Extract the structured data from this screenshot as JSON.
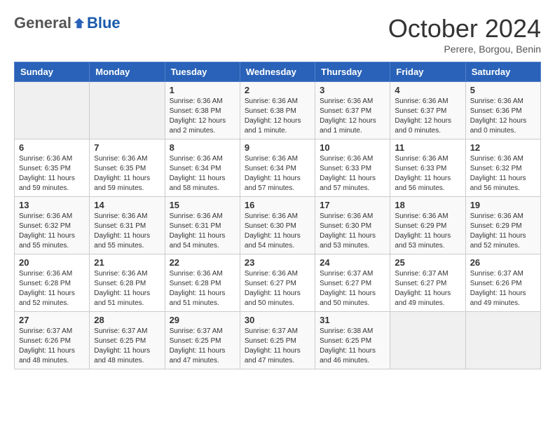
{
  "header": {
    "logo_general": "General",
    "logo_blue": "Blue",
    "month_title": "October 2024",
    "subtitle": "Perere, Borgou, Benin"
  },
  "days_of_week": [
    "Sunday",
    "Monday",
    "Tuesday",
    "Wednesday",
    "Thursday",
    "Friday",
    "Saturday"
  ],
  "weeks": [
    [
      {
        "day": "",
        "detail": ""
      },
      {
        "day": "",
        "detail": ""
      },
      {
        "day": "1",
        "detail": "Sunrise: 6:36 AM\nSunset: 6:38 PM\nDaylight: 12 hours\nand 2 minutes."
      },
      {
        "day": "2",
        "detail": "Sunrise: 6:36 AM\nSunset: 6:38 PM\nDaylight: 12 hours\nand 1 minute."
      },
      {
        "day": "3",
        "detail": "Sunrise: 6:36 AM\nSunset: 6:37 PM\nDaylight: 12 hours\nand 1 minute."
      },
      {
        "day": "4",
        "detail": "Sunrise: 6:36 AM\nSunset: 6:37 PM\nDaylight: 12 hours\nand 0 minutes."
      },
      {
        "day": "5",
        "detail": "Sunrise: 6:36 AM\nSunset: 6:36 PM\nDaylight: 12 hours\nand 0 minutes."
      }
    ],
    [
      {
        "day": "6",
        "detail": "Sunrise: 6:36 AM\nSunset: 6:35 PM\nDaylight: 11 hours\nand 59 minutes."
      },
      {
        "day": "7",
        "detail": "Sunrise: 6:36 AM\nSunset: 6:35 PM\nDaylight: 11 hours\nand 59 minutes."
      },
      {
        "day": "8",
        "detail": "Sunrise: 6:36 AM\nSunset: 6:34 PM\nDaylight: 11 hours\nand 58 minutes."
      },
      {
        "day": "9",
        "detail": "Sunrise: 6:36 AM\nSunset: 6:34 PM\nDaylight: 11 hours\nand 57 minutes."
      },
      {
        "day": "10",
        "detail": "Sunrise: 6:36 AM\nSunset: 6:33 PM\nDaylight: 11 hours\nand 57 minutes."
      },
      {
        "day": "11",
        "detail": "Sunrise: 6:36 AM\nSunset: 6:33 PM\nDaylight: 11 hours\nand 56 minutes."
      },
      {
        "day": "12",
        "detail": "Sunrise: 6:36 AM\nSunset: 6:32 PM\nDaylight: 11 hours\nand 56 minutes."
      }
    ],
    [
      {
        "day": "13",
        "detail": "Sunrise: 6:36 AM\nSunset: 6:32 PM\nDaylight: 11 hours\nand 55 minutes."
      },
      {
        "day": "14",
        "detail": "Sunrise: 6:36 AM\nSunset: 6:31 PM\nDaylight: 11 hours\nand 55 minutes."
      },
      {
        "day": "15",
        "detail": "Sunrise: 6:36 AM\nSunset: 6:31 PM\nDaylight: 11 hours\nand 54 minutes."
      },
      {
        "day": "16",
        "detail": "Sunrise: 6:36 AM\nSunset: 6:30 PM\nDaylight: 11 hours\nand 54 minutes."
      },
      {
        "day": "17",
        "detail": "Sunrise: 6:36 AM\nSunset: 6:30 PM\nDaylight: 11 hours\nand 53 minutes."
      },
      {
        "day": "18",
        "detail": "Sunrise: 6:36 AM\nSunset: 6:29 PM\nDaylight: 11 hours\nand 53 minutes."
      },
      {
        "day": "19",
        "detail": "Sunrise: 6:36 AM\nSunset: 6:29 PM\nDaylight: 11 hours\nand 52 minutes."
      }
    ],
    [
      {
        "day": "20",
        "detail": "Sunrise: 6:36 AM\nSunset: 6:28 PM\nDaylight: 11 hours\nand 52 minutes."
      },
      {
        "day": "21",
        "detail": "Sunrise: 6:36 AM\nSunset: 6:28 PM\nDaylight: 11 hours\nand 51 minutes."
      },
      {
        "day": "22",
        "detail": "Sunrise: 6:36 AM\nSunset: 6:28 PM\nDaylight: 11 hours\nand 51 minutes."
      },
      {
        "day": "23",
        "detail": "Sunrise: 6:36 AM\nSunset: 6:27 PM\nDaylight: 11 hours\nand 50 minutes."
      },
      {
        "day": "24",
        "detail": "Sunrise: 6:37 AM\nSunset: 6:27 PM\nDaylight: 11 hours\nand 50 minutes."
      },
      {
        "day": "25",
        "detail": "Sunrise: 6:37 AM\nSunset: 6:27 PM\nDaylight: 11 hours\nand 49 minutes."
      },
      {
        "day": "26",
        "detail": "Sunrise: 6:37 AM\nSunset: 6:26 PM\nDaylight: 11 hours\nand 49 minutes."
      }
    ],
    [
      {
        "day": "27",
        "detail": "Sunrise: 6:37 AM\nSunset: 6:26 PM\nDaylight: 11 hours\nand 48 minutes."
      },
      {
        "day": "28",
        "detail": "Sunrise: 6:37 AM\nSunset: 6:25 PM\nDaylight: 11 hours\nand 48 minutes."
      },
      {
        "day": "29",
        "detail": "Sunrise: 6:37 AM\nSunset: 6:25 PM\nDaylight: 11 hours\nand 47 minutes."
      },
      {
        "day": "30",
        "detail": "Sunrise: 6:37 AM\nSunset: 6:25 PM\nDaylight: 11 hours\nand 47 minutes."
      },
      {
        "day": "31",
        "detail": "Sunrise: 6:38 AM\nSunset: 6:25 PM\nDaylight: 11 hours\nand 46 minutes."
      },
      {
        "day": "",
        "detail": ""
      },
      {
        "day": "",
        "detail": ""
      }
    ]
  ]
}
